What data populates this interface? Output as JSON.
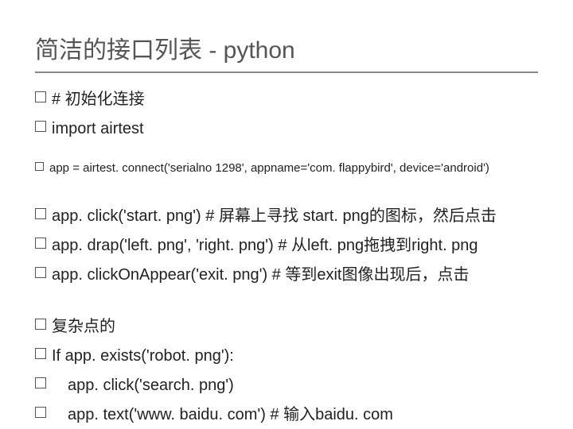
{
  "title": "简洁的接口列表 - python",
  "lines": [
    {
      "cls": "txt",
      "text": "# 初始化连接"
    },
    {
      "cls": "txt",
      "text": "import airtest"
    }
  ],
  "lines2": [
    {
      "cls": "txt small",
      "text": "app = airtest. connect('serialno 1298',  appname='com. flappybird', device='android')"
    }
  ],
  "lines3": [
    {
      "cls": "txt",
      "text": "app. click('start. png')   # 屏幕上寻找  start. png的图标，然后点击"
    },
    {
      "cls": "txt",
      "text": "app. drap('left. png',  'right. png') # 从left. png拖拽到right. png"
    },
    {
      "cls": "txt",
      "text": "app. clickOnAppear('exit. png') # 等到exit图像出现后，点击"
    }
  ],
  "lines4": [
    {
      "cls": "txt",
      "text": "复杂点的"
    },
    {
      "cls": "txt",
      "text": "If app. exists('robot. png'):"
    },
    {
      "cls": "txt indent",
      "text": "app. click('search. png')"
    },
    {
      "cls": "txt indent",
      "text": "app. text('www. baidu. com') # 输入baidu. com"
    }
  ]
}
